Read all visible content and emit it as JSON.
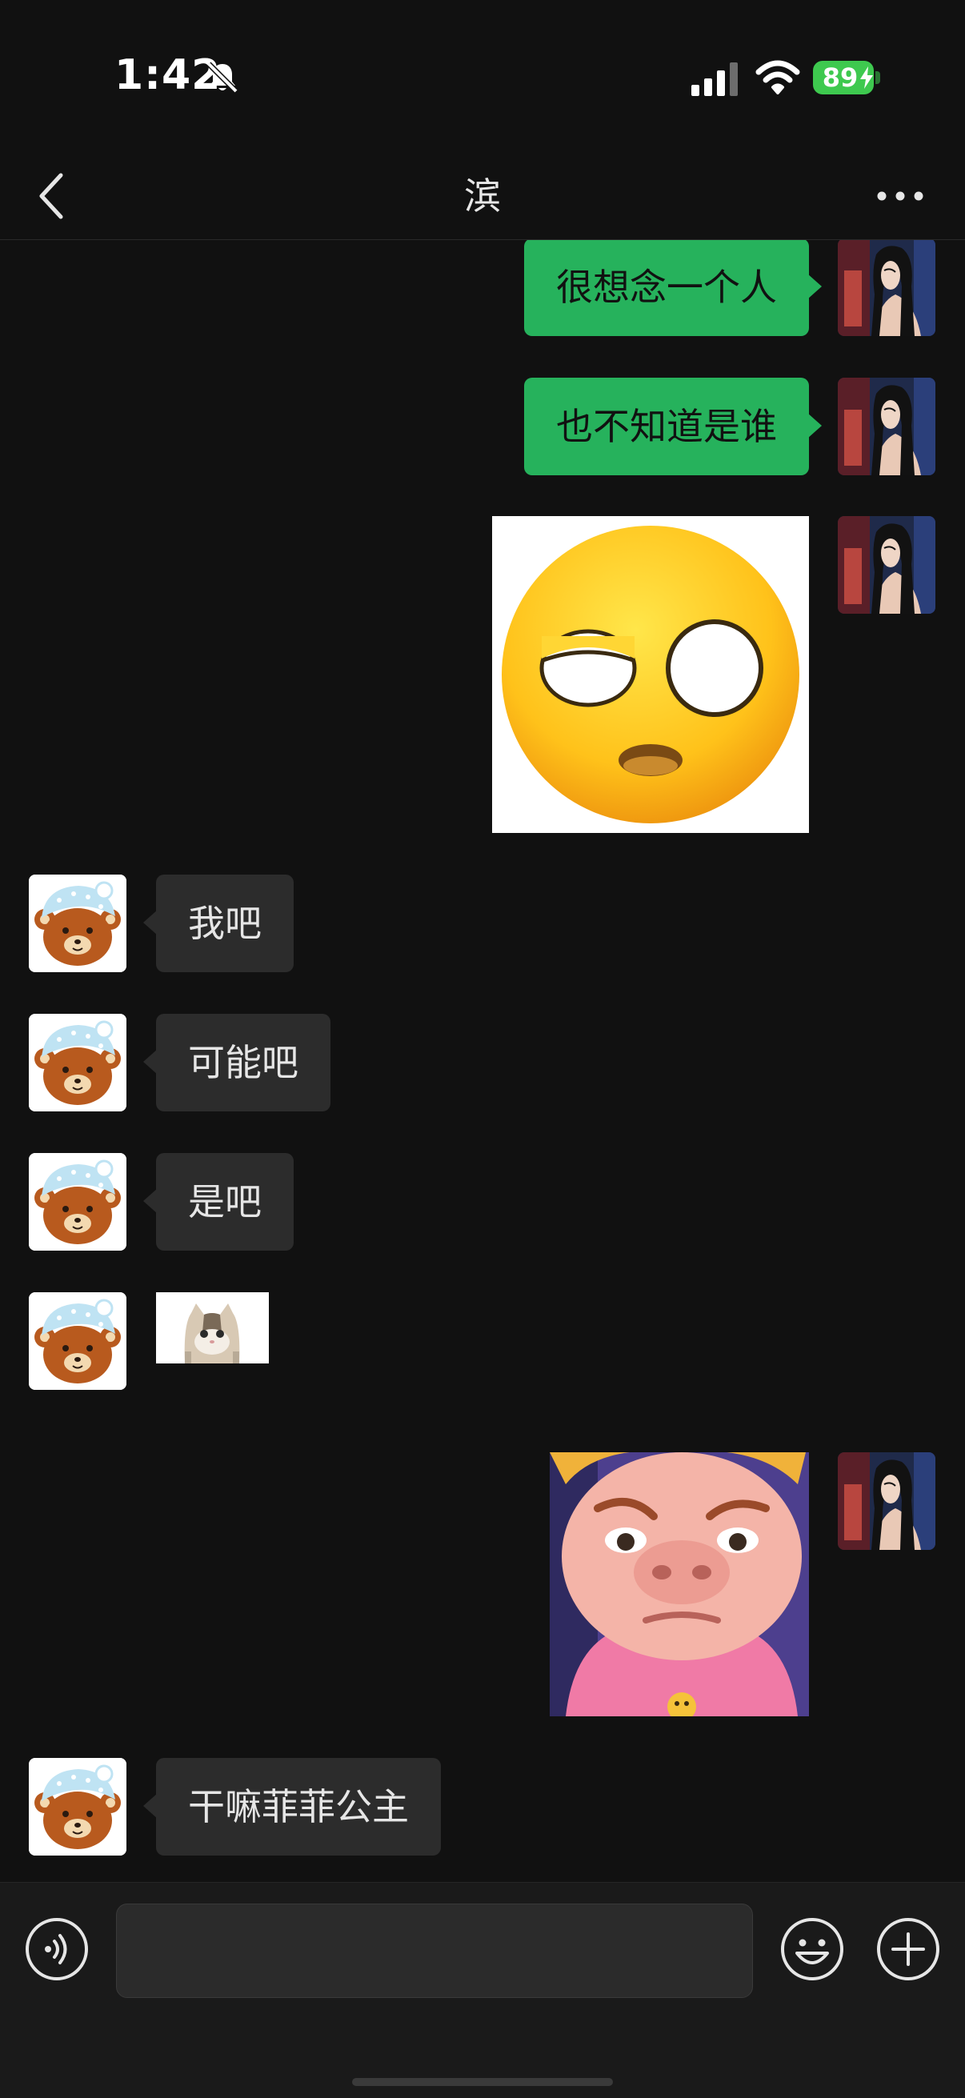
{
  "status_bar": {
    "time": "1:42",
    "battery_percent": "89",
    "icons": [
      "bell-slash-icon",
      "cellular-signal-icon",
      "wifi-icon",
      "battery-charging-icon"
    ],
    "battery_color": "#3ec94f"
  },
  "nav": {
    "title": "滨",
    "icons": [
      "chevron-left-icon",
      "more-dots-icon"
    ]
  },
  "colors": {
    "background": "#111111",
    "self_bubble": "#26b25c",
    "peer_bubble": "#2c2c2c"
  },
  "messages": [
    {
      "sender": "self",
      "type": "text",
      "text": "很想念一个人"
    },
    {
      "sender": "self",
      "type": "text",
      "text": "也不知道是谁"
    },
    {
      "sender": "self",
      "type": "sticker",
      "sticker": "eye-roll-emoji-sticker"
    },
    {
      "sender": "peer",
      "type": "text",
      "text": "我吧"
    },
    {
      "sender": "peer",
      "type": "text",
      "text": "可能吧"
    },
    {
      "sender": "peer",
      "type": "text",
      "text": "是吧"
    },
    {
      "sender": "peer",
      "type": "sticker",
      "sticker": "cat-sticker"
    },
    {
      "sender": "self",
      "type": "sticker",
      "sticker": "pig-face-girl-sticker"
    },
    {
      "sender": "peer",
      "type": "text",
      "text": "干嘛菲菲公主"
    }
  ],
  "input_bar": {
    "value": "",
    "placeholder": "",
    "icons": [
      "voice-icon",
      "emoji-icon",
      "plus-icon"
    ]
  }
}
